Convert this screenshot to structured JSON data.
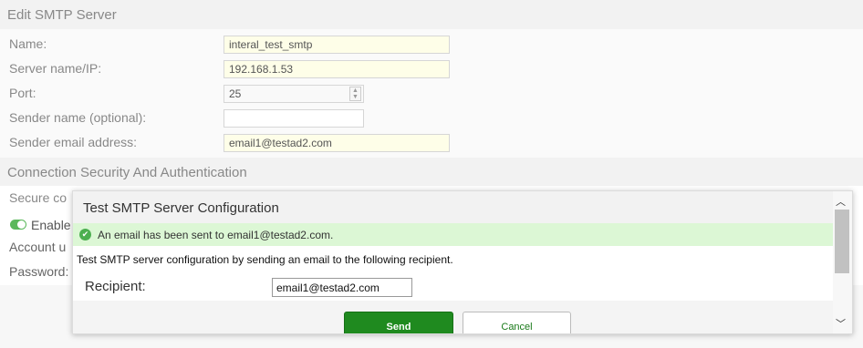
{
  "edit_section": {
    "title": "Edit SMTP Server"
  },
  "form": {
    "name": {
      "label": "Name:",
      "value": "interal_test_smtp"
    },
    "server": {
      "label": "Server name/IP:",
      "value": "192.168.1.53"
    },
    "port": {
      "label": "Port:",
      "value": "25"
    },
    "sender_name": {
      "label": "Sender name (optional):",
      "value": ""
    },
    "sender_email": {
      "label": "Sender email address:",
      "value": "email1@testad2.com"
    }
  },
  "security_section": {
    "title": "Connection Security And Authentication",
    "secure_label": "Secure co",
    "enable_label": "Enable",
    "account_label": "Account u",
    "password_label": "Password:"
  },
  "dialog": {
    "title": "Test SMTP Server Configuration",
    "success_message": "An email has been sent to email1@testad2.com.",
    "description": "Test SMTP server configuration by sending an email to the following recipient.",
    "recipient_label": "Recipient:",
    "recipient_value": "email1@testad2.com",
    "send_label": "Send",
    "cancel_label": "Cancel"
  },
  "icons": {
    "check": "check-circle-icon",
    "scroll_up": "chevron-up-icon",
    "scroll_down": "chevron-down-icon"
  }
}
